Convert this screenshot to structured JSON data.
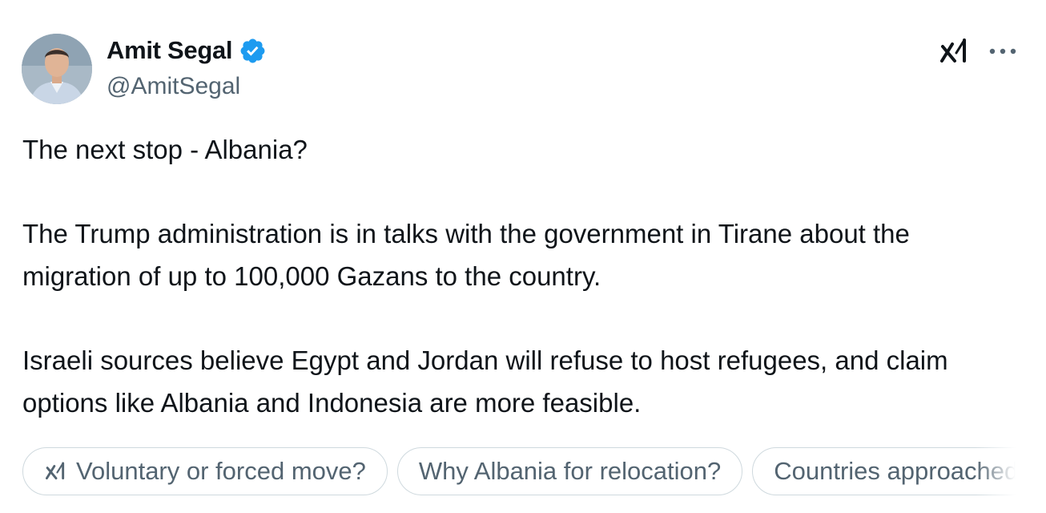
{
  "author": {
    "name": "Amit Segal",
    "handle": "@AmitSegal",
    "verified": true,
    "verified_color": "#1d9bf0"
  },
  "header_icons": {
    "grok": "grok-icon",
    "more": "more-icon"
  },
  "tweet": {
    "paragraphs": [
      "The next stop - Albania?",
      "The Trump administration is in talks with the government in Tirane about the migration of up to 100,000 Gazans to the country.",
      "Israeli sources believe Egypt and Jordan will refuse to host refugees, and claim options like Albania and Indonesia are more feasible."
    ]
  },
  "suggestions": [
    {
      "label": "Voluntary or forced move?",
      "icon": "grok-icon"
    },
    {
      "label": "Why Albania for relocation?"
    },
    {
      "label": "Countries approached"
    }
  ],
  "colors": {
    "text": "#0f1419",
    "secondary": "#536471",
    "border": "#cfd9de"
  }
}
